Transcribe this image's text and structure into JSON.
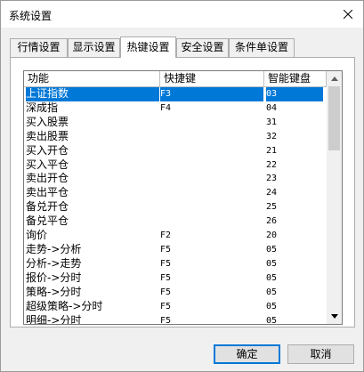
{
  "window": {
    "title": "系统设置"
  },
  "tabs": [
    {
      "label": "行情设置",
      "active": false
    },
    {
      "label": "显示设置",
      "active": false
    },
    {
      "label": "热键设置",
      "active": true
    },
    {
      "label": "安全设置",
      "active": false
    },
    {
      "label": "条件单设置",
      "active": false
    }
  ],
  "table": {
    "columns": [
      "功能",
      "快捷键",
      "智能键盘"
    ],
    "rows": [
      {
        "func": "上证指数",
        "key": "F3",
        "smart": "03",
        "selected": true
      },
      {
        "func": "深成指",
        "key": "F4",
        "smart": "04",
        "selected": false
      },
      {
        "func": "买入股票",
        "key": "",
        "smart": "31",
        "selected": false
      },
      {
        "func": "卖出股票",
        "key": "",
        "smart": "32",
        "selected": false
      },
      {
        "func": "买入开仓",
        "key": "",
        "smart": "21",
        "selected": false
      },
      {
        "func": "买入平仓",
        "key": "",
        "smart": "22",
        "selected": false
      },
      {
        "func": "卖出开仓",
        "key": "",
        "smart": "23",
        "selected": false
      },
      {
        "func": "卖出平仓",
        "key": "",
        "smart": "24",
        "selected": false
      },
      {
        "func": "备兑开仓",
        "key": "",
        "smart": "25",
        "selected": false
      },
      {
        "func": "备兑平仓",
        "key": "",
        "smart": "26",
        "selected": false
      },
      {
        "func": "询价",
        "key": "F2",
        "smart": "20",
        "selected": false
      },
      {
        "func": "走势->分析",
        "key": "F5",
        "smart": "05",
        "selected": false
      },
      {
        "func": "分析->走势",
        "key": "F5",
        "smart": "05",
        "selected": false
      },
      {
        "func": "报价->分时",
        "key": "F5",
        "smart": "05",
        "selected": false
      },
      {
        "func": "策略->分时",
        "key": "F5",
        "smart": "05",
        "selected": false
      },
      {
        "func": "超级策略->分时",
        "key": "F5",
        "smart": "05",
        "selected": false
      },
      {
        "func": "明细->分时",
        "key": "F5",
        "smart": "05",
        "selected": false
      }
    ]
  },
  "buttons": {
    "ok": "确定",
    "cancel": "取消"
  },
  "icons": {
    "close": "close-icon",
    "scroll_up": "scroll-up-arrow-icon",
    "scroll_down": "scroll-down-arrow-icon"
  },
  "colors": {
    "selection": "#0078d7",
    "default_button_border": "#0078d7"
  }
}
